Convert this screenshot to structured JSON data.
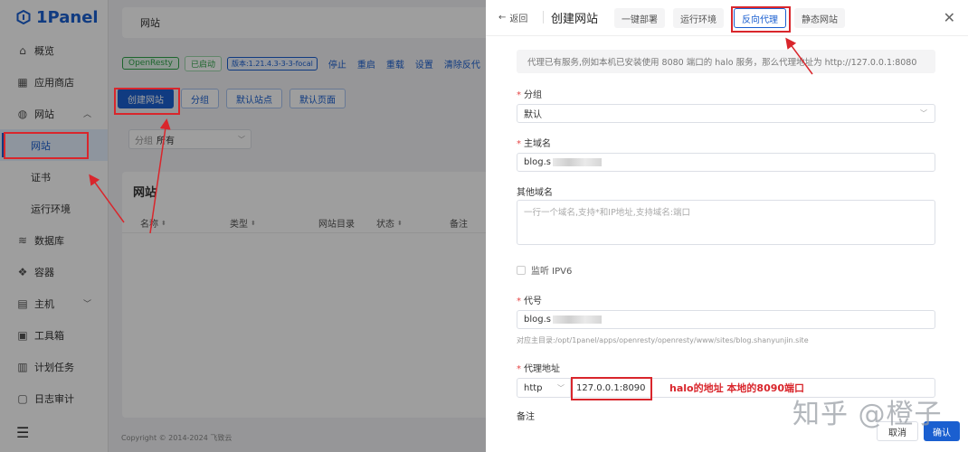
{
  "app": {
    "logo": "1Panel"
  },
  "sidebar": {
    "items": [
      {
        "label": "概览",
        "icon": "home-icon"
      },
      {
        "label": "应用商店",
        "icon": "grid-icon"
      },
      {
        "label": "网站",
        "icon": "globe-icon"
      },
      {
        "label": "网站",
        "icon": ""
      },
      {
        "label": "证书",
        "icon": ""
      },
      {
        "label": "运行环境",
        "icon": ""
      },
      {
        "label": "数据库",
        "icon": "database-icon"
      },
      {
        "label": "容器",
        "icon": "container-icon"
      },
      {
        "label": "主机",
        "icon": "host-icon"
      },
      {
        "label": "工具箱",
        "icon": "toolbox-icon"
      },
      {
        "label": "计划任务",
        "icon": "calendar-icon"
      },
      {
        "label": "日志审计",
        "icon": "log-icon"
      }
    ]
  },
  "main": {
    "breadcrumb": "网站",
    "status": {
      "app": "OpenResty",
      "state": "已启动",
      "version": "版本:1.21.4.3-3-3-focal",
      "actions": [
        "停止",
        "重启",
        "重载",
        "设置",
        "清除反代"
      ]
    },
    "buttons": [
      "创建网站",
      "分组",
      "默认站点",
      "默认页面"
    ],
    "filter": {
      "label": "分组",
      "value": "所有"
    },
    "card_title": "网站",
    "columns": [
      "名称",
      "类型",
      "网站目录",
      "状态",
      "备注"
    ],
    "copyright": "Copyright © 2014-2024 飞致云"
  },
  "drawer": {
    "back": "返回",
    "title": "创建网站",
    "tabs": [
      "一键部署",
      "运行环境",
      "反向代理",
      "静态网站"
    ],
    "notice": "代理已有服务,例如本机已安装使用 8080 端口的 halo 服务，那么代理地址为 http://127.0.0.1:8080",
    "group_label": "分组",
    "group_value": "默认",
    "domain_label": "主域名",
    "domain_value": "blog.s",
    "other_domain_label": "其他域名",
    "other_domain_placeholder": "一行一个域名,支持*和IP地址,支持域名:端口",
    "ipv6_label": "监听 IPV6",
    "alias_label": "代号",
    "alias_value": "blog.s",
    "site_dir_hint": "对应主目录:/opt/1panel/apps/openresty/openresty/www/sites/blog.shanyunjin.site",
    "proxy_label": "代理地址",
    "proxy_scheme": "http",
    "proxy_address": "127.0.0.1:8090",
    "remark_label": "备注",
    "cancel": "取消",
    "confirm": "确认"
  },
  "annotations": {
    "proxy_note": "halo的地址 本地的8090端口",
    "watermark": "知乎 @橙子"
  }
}
